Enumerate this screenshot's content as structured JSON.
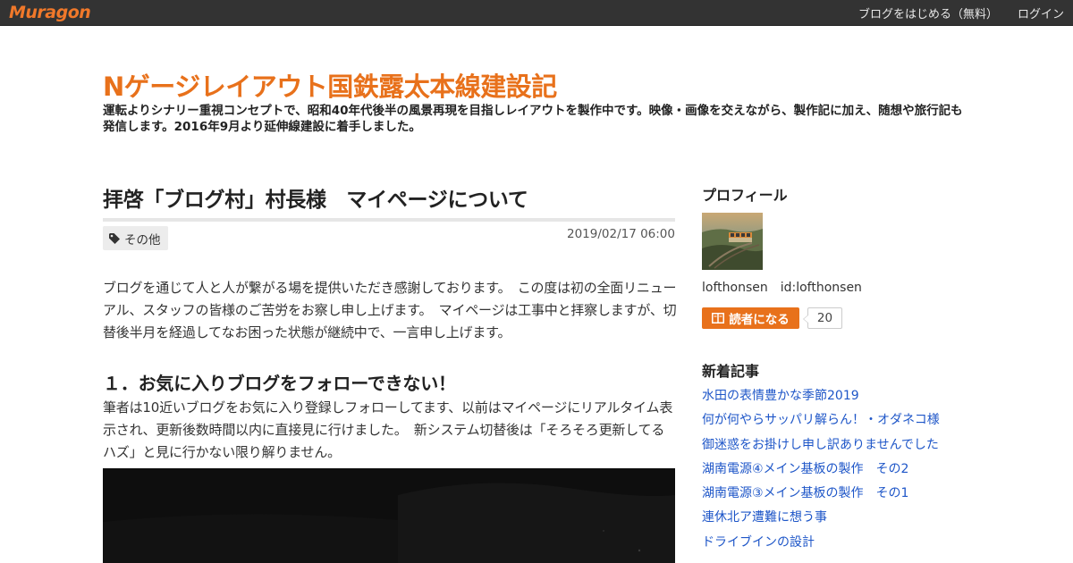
{
  "topbar": {
    "logo": "Muragon",
    "start_blog": "ブログをはじめる（無料）",
    "login": "ログイン"
  },
  "blog": {
    "title": "Nゲージレイアウト国鉄露太本線建設記",
    "description": "運転よりシナリー重視コンセプトで、昭和40年代後半の風景再現を目指しレイアウトを製作中です。映像・画像を交えながら、製作記に加え、随想や旅行記も発信します。2016年9月より延伸線建設に着手しました。"
  },
  "article": {
    "title": "拝啓「ブログ村」村長様　マイページについて",
    "tag": "その他",
    "date": "2019/02/17 06:00",
    "paragraph1": "ブログを通じて人と人が繋がる場を提供いただき感謝しております。　この度は初の全面リニューアル、スタッフの皆様のご苦労をお察し申し上げます。　マイページは工事中と拝察しますが、切替後半月を経過してなお困った状態が継続中で、一言申し上げます。",
    "section_heading": "１．お気に入りブログをフォローできない！",
    "paragraph2": "筆者は10近いブログをお気に入り登録しフォローしてます、以前はマイページにリアルタイム表示され、更新後数時間以内に直接見に行けました。　新システム切替後は「そろそろ更新してるハズ」と見に行かない限り解りません。"
  },
  "sidebar": {
    "profile_heading": "プロフィール",
    "profile_name": "lofthonsen　id:lofthonsen",
    "follow_label": "読者になる",
    "follower_count": "20",
    "recent_heading": "新着記事",
    "recent_posts": [
      "水田の表情豊かな季節2019",
      "何が何やらサッパリ解らん！・オダネコ様",
      "御迷惑をお掛けし申し訳ありませんでした",
      "湖南電源④メイン基板の製作　その2",
      "湖南電源③メイン基板の製作　その1",
      "連休北ア遭難に想う事",
      "ドライブインの設計"
    ]
  },
  "colors": {
    "accent": "#e8711b",
    "topbar": "#333333",
    "link": "#1e56c8"
  },
  "icons": {
    "tag": "tag-icon",
    "follow": "book-icon"
  }
}
